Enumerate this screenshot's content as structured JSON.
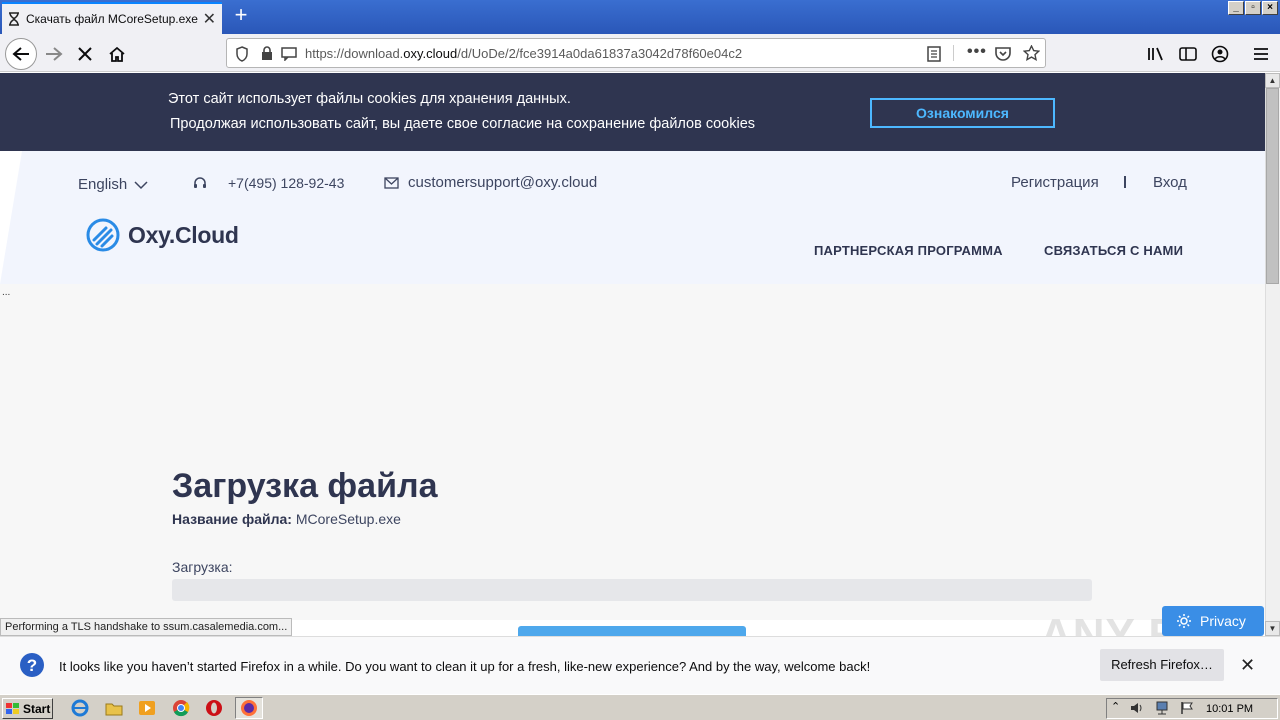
{
  "browser": {
    "tab_title": "Скачать файл MCoreSetup.exe н",
    "url_prefix": "https://download.",
    "url_domain": "oxy.cloud",
    "url_path": "/d/UoDe/2/fce3914a0da61837a3042d78f60e04c2",
    "status_text": "Performing a TLS handshake to ssum.casalemedia.com..."
  },
  "cookie_banner": {
    "line1": "Этот сайт использует файлы cookies для хранения данных.",
    "line2": "Продолжая использовать сайт, вы даете свое согласие на сохранение файлов cookies",
    "button": "Ознакомился"
  },
  "header": {
    "language": "English",
    "phone": "+7(495) 128-92-43",
    "email": "customersupport@oxy.cloud",
    "register": "Регистрация",
    "login": "Вход",
    "logo": "Oxy.Cloud",
    "nav": [
      "ПАРТНЕРСКАЯ ПРОГРАММА",
      "СВЯЗАТЬСЯ С НАМИ"
    ]
  },
  "main": {
    "ellipsis": "...",
    "title": "Загрузка файла",
    "filename_label": "Название файла:",
    "filename": "MCoreSetup.exe",
    "download_label": "Загрузка:",
    "progress": 0
  },
  "privacy_button": "Privacy",
  "watermark": "ANY RUN",
  "notification": {
    "text": "It looks like you haven’t started Firefox in a while. Do you want to clean it up for a fresh, like-new experience? And by the way, welcome back!",
    "button": "Refresh Firefox…"
  },
  "taskbar": {
    "start": "Start",
    "clock": "10:01 PM"
  },
  "colors": {
    "cookie_bg": "#2f3550",
    "accent": "#4db8ff",
    "header_bg": "#f2f5fd",
    "brand_dark": "#2f3550"
  }
}
